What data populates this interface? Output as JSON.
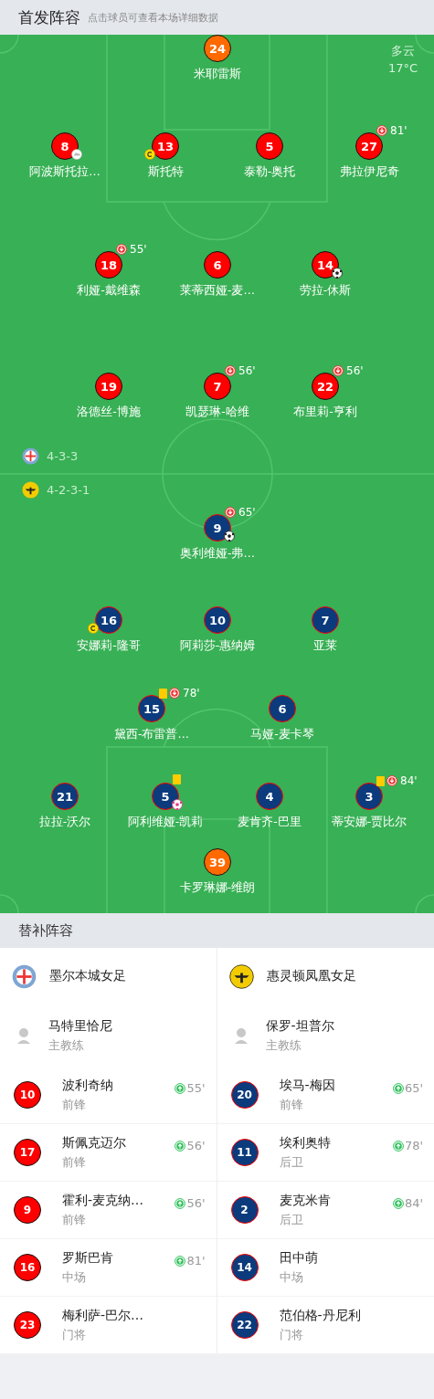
{
  "header": {
    "title": "首发阵容",
    "hint": "点击球员可查看本场详细数据"
  },
  "pitch": {
    "weather": {
      "condition": "多云",
      "temperature": "17°C"
    },
    "home": {
      "formation": "4-3-3",
      "lines": [
        [
          {
            "number": "24",
            "name": "米耶雷斯",
            "kind": "goalkeeper",
            "captain": false
          }
        ],
        [
          {
            "number": "8",
            "name": "阿波斯托拉…",
            "kind": "outfield",
            "captain": false,
            "events": [
              {
                "kind": "assist"
              }
            ]
          },
          {
            "number": "13",
            "name": "斯托特",
            "kind": "outfield",
            "captain": true
          },
          {
            "number": "5",
            "name": "泰勒-奥托",
            "kind": "outfield",
            "captain": false
          },
          {
            "number": "27",
            "name": "弗拉伊尼奇",
            "kind": "outfield",
            "captain": false,
            "events": [
              {
                "kind": "sub_off",
                "minute": "81'"
              }
            ]
          }
        ],
        [
          {
            "number": "18",
            "name": "利娅-戴维森",
            "kind": "outfield",
            "captain": false,
            "events": [
              {
                "kind": "sub_off",
                "minute": "55'"
              }
            ]
          },
          {
            "number": "6",
            "name": "莱蒂西娅-麦…",
            "kind": "outfield",
            "captain": false
          },
          {
            "number": "14",
            "name": "劳拉-休斯",
            "kind": "outfield",
            "captain": false,
            "events": [
              {
                "kind": "goal"
              }
            ]
          }
        ],
        [
          {
            "number": "19",
            "name": "洛德丝-博施",
            "kind": "outfield",
            "captain": false
          },
          {
            "number": "7",
            "name": "凯瑟琳-哈维",
            "kind": "outfield",
            "captain": false,
            "events": [
              {
                "kind": "sub_off",
                "minute": "56'"
              }
            ]
          },
          {
            "number": "22",
            "name": "布里莉-亨利",
            "kind": "outfield",
            "captain": false,
            "events": [
              {
                "kind": "sub_off",
                "minute": "56'"
              }
            ]
          }
        ]
      ]
    },
    "away": {
      "formation": "4-2-3-1",
      "lines": [
        [
          {
            "number": "9",
            "name": "奥利维娅-弗…",
            "kind": "outfield",
            "captain": false,
            "events": [
              {
                "kind": "sub_off",
                "minute": "65'"
              },
              {
                "kind": "goal"
              }
            ]
          }
        ],
        [
          {
            "number": "16",
            "name": "安娜莉-隆哥",
            "kind": "outfield",
            "captain": true
          },
          {
            "number": "10",
            "name": "阿莉莎-惠纳姆",
            "kind": "outfield",
            "captain": false
          },
          {
            "number": "7",
            "name": "亚莱",
            "kind": "outfield",
            "captain": false
          }
        ],
        [
          {
            "number": "15",
            "name": "黛西-布雷普…",
            "kind": "outfield",
            "captain": false,
            "events": [
              {
                "kind": "yellow"
              },
              {
                "kind": "sub_off",
                "minute": "78'"
              }
            ]
          },
          {
            "number": "6",
            "name": "马娅-麦卡琴",
            "kind": "outfield",
            "captain": false
          }
        ],
        [
          {
            "number": "21",
            "name": "拉拉-沃尔",
            "kind": "outfield",
            "captain": false
          },
          {
            "number": "5",
            "name": "阿利维娅-凯莉",
            "kind": "outfield",
            "captain": false,
            "events": [
              {
                "kind": "yellow"
              },
              {
                "kind": "own_goal"
              }
            ]
          },
          {
            "number": "4",
            "name": "麦肯齐-巴里",
            "kind": "outfield",
            "captain": false
          },
          {
            "number": "3",
            "name": "蒂安娜-贾比尔",
            "kind": "outfield",
            "captain": false,
            "events": [
              {
                "kind": "yellow"
              },
              {
                "kind": "sub_off",
                "minute": "84'"
              }
            ]
          }
        ],
        [
          {
            "number": "39",
            "name": "卡罗琳娜-维朗",
            "kind": "goalkeeper",
            "captain": false
          }
        ]
      ]
    }
  },
  "bench": {
    "title": "替补阵容",
    "teams": [
      {
        "kind": "home",
        "name": "墨尔本城女足",
        "coach": {
          "name": "马特里恰尼",
          "role": "主教练"
        },
        "subs": [
          {
            "number": "10",
            "name": "波利奇纳",
            "position": "前锋",
            "on_minute": "55'"
          },
          {
            "number": "17",
            "name": "斯佩克迈尔",
            "position": "前锋",
            "on_minute": "56'"
          },
          {
            "number": "9",
            "name": "霍利-麦克纳…",
            "position": "前锋",
            "on_minute": "56'"
          },
          {
            "number": "16",
            "name": "罗斯巴肯",
            "position": "中场",
            "on_minute": "81'"
          },
          {
            "number": "23",
            "name": "梅利萨-巴尔…",
            "position": "门将"
          }
        ]
      },
      {
        "kind": "away",
        "name": "惠灵顿凤凰女足",
        "coach": {
          "name": "保罗-坦普尔",
          "role": "主教练"
        },
        "subs": [
          {
            "number": "20",
            "name": "埃马-梅因",
            "position": "前锋",
            "on_minute": "65'"
          },
          {
            "number": "11",
            "name": "埃利奥特",
            "position": "后卫",
            "on_minute": "78'"
          },
          {
            "number": "2",
            "name": "麦克米肯",
            "position": "后卫",
            "on_minute": "84'"
          },
          {
            "number": "14",
            "name": "田中萌",
            "position": "中场"
          },
          {
            "number": "22",
            "name": "范伯格-丹尼利",
            "position": "门将"
          }
        ]
      }
    ]
  }
}
